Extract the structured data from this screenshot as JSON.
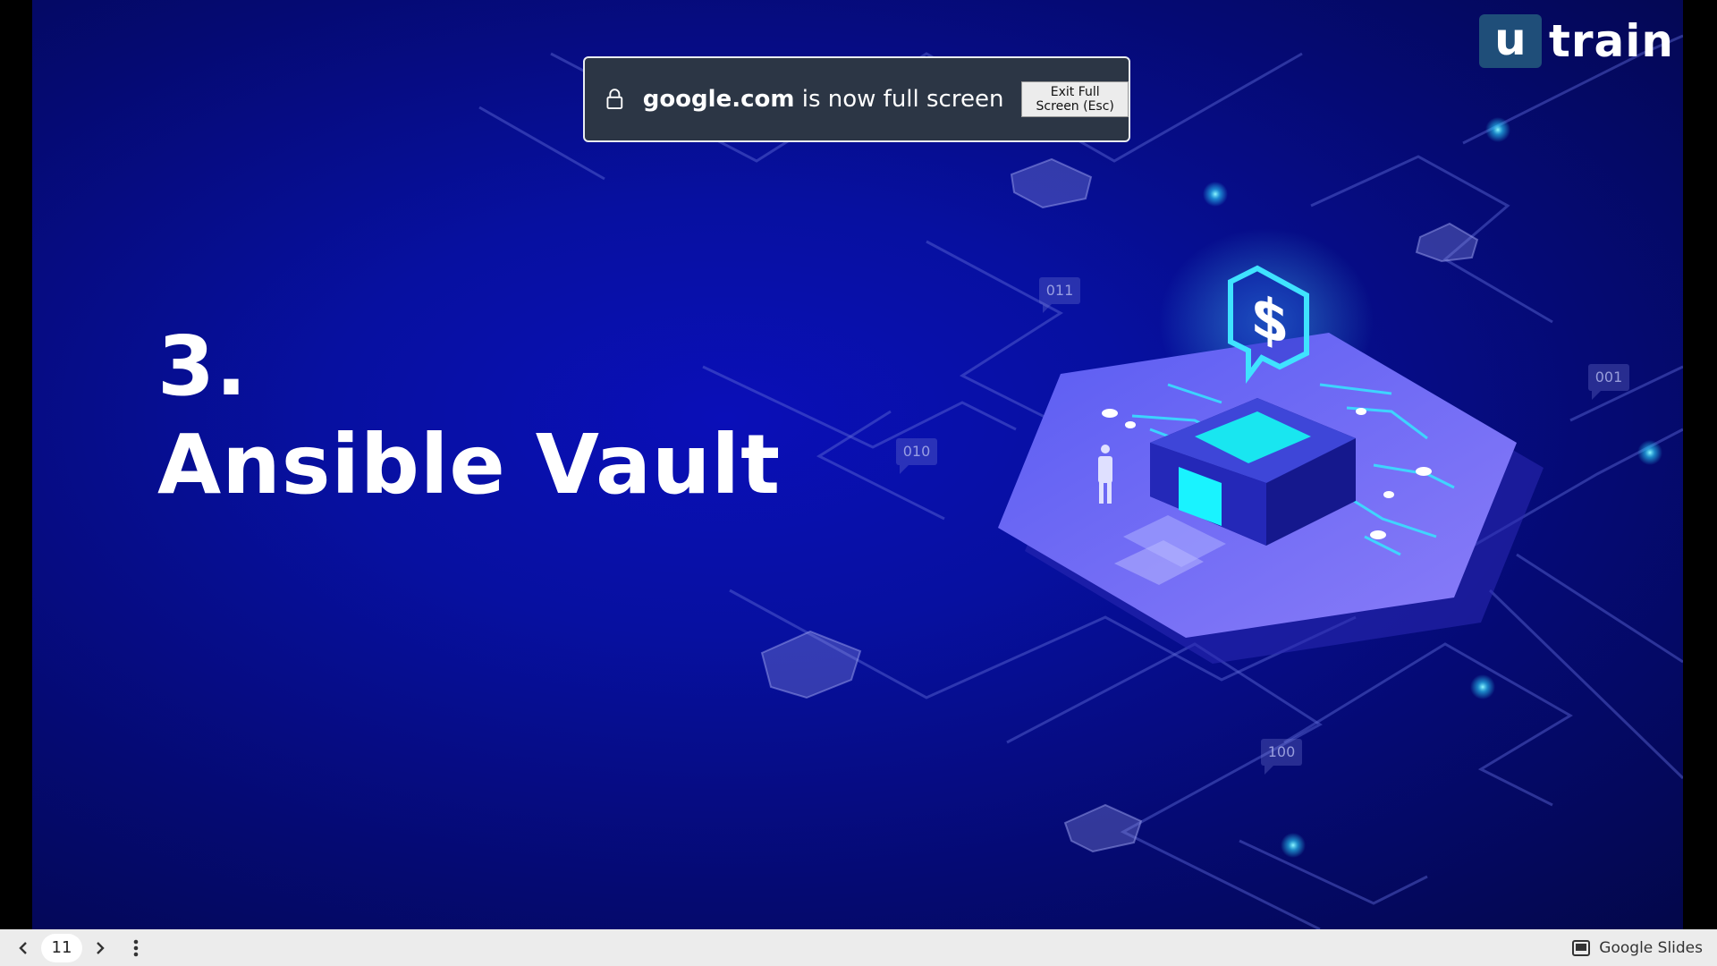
{
  "slide": {
    "number_label": "3.",
    "title": "Ansible Vault",
    "binary_tags": [
      "011",
      "010",
      "001",
      "100"
    ],
    "vault_symbol": "$"
  },
  "logo": {
    "u": "u",
    "text": "train"
  },
  "fullscreen_banner": {
    "domain": "google.com",
    "message": " is now full screen",
    "exit_button": "Exit Full Screen (Esc)"
  },
  "bottom_bar": {
    "prev_icon": "chevron-left-icon",
    "page_number": "11",
    "next_icon": "chevron-right-icon",
    "menu_icon": "more-vert-icon",
    "app_label": "Google Slides"
  },
  "colors": {
    "slide_bg": "#0710a0",
    "logo_bg": "#1f4e79",
    "banner_bg": "#2c3645",
    "platform": "#6a6cf6",
    "accent_cyan": "#19e6f0"
  }
}
